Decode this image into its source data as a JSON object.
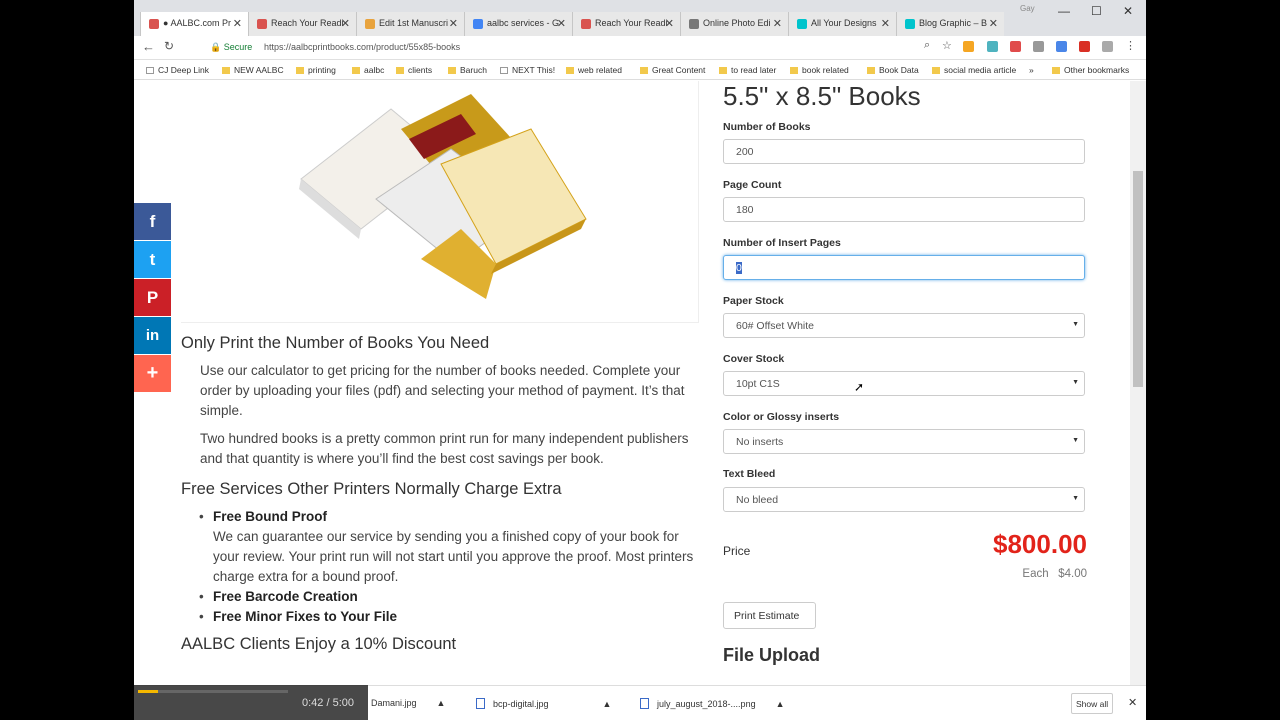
{
  "browser": {
    "tabs": [
      {
        "label": "● AALBC.com Pr",
        "color": "#d9534f"
      },
      {
        "label": "Reach Your Readi",
        "color": "#d9534f"
      },
      {
        "label": "Edit 1st Manuscri",
        "color": "#e8a33d"
      },
      {
        "label": "aalbc services - G",
        "color": "#4285f4"
      },
      {
        "label": "Reach Your Readi",
        "color": "#d9534f"
      },
      {
        "label": "Online Photo Edi",
        "color": "#777777"
      },
      {
        "label": "All Your Designs",
        "color": "#00c4cc"
      },
      {
        "label": "Blog Graphic – B",
        "color": "#00c4cc"
      }
    ],
    "user_label": "Gay",
    "secure_label": "Secure",
    "url": "https://aalbcprintbooks.com/product/55x85-books",
    "bookmarks": [
      "CJ Deep Link",
      "NEW AALBC",
      "printing",
      "aalbc",
      "clients",
      "Baruch",
      "NEXT This!",
      "web related",
      "Great Content",
      "to read later",
      "book related",
      "Book Data",
      "social media article"
    ],
    "other_bookmarks": "Other bookmarks"
  },
  "left": {
    "heading1": "Only Print the Number of Books You Need",
    "para1": "Use our calculator to get pricing for the number of books needed. Complete your order by uploading your files (pdf) and selecting your method of payment. It’s that simple.",
    "para2": "Two hundred books is a pretty common print run for many independent publishers and that quantity is where you’ll find the best cost savings per book.",
    "heading2": "Free Services Other Printers Normally Charge Extra",
    "bullet1_title": "Free Bound Proof",
    "bullet1_text": "We can guarantee our service by sending you a finished copy of your book for your review.  Your print run will not start until you approve the proof.  Most printers charge extra for a bound proof.",
    "bullet2_title": "Free Barcode Creation",
    "bullet3_title": "Free Minor Fixes to Your File",
    "heading3": "AALBC Clients Enjoy a 10% Discount"
  },
  "share": {
    "facebook": "f",
    "twitter": "t",
    "pinterest": "P",
    "linkedin": "in",
    "more": "+"
  },
  "form": {
    "title": "5.5\" x 8.5\" Books",
    "num_books_label": "Number of Books",
    "num_books_value": "200",
    "page_count_label": "Page Count",
    "page_count_value": "180",
    "insert_pages_label": "Number of Insert Pages",
    "insert_pages_value": "0",
    "paper_stock_label": "Paper Stock",
    "paper_stock_value": "60# Offset White",
    "cover_stock_label": "Cover Stock",
    "cover_stock_value": "10pt C1S",
    "glossy_label": "Color or Glossy inserts",
    "glossy_value": "No inserts",
    "bleed_label": "Text Bleed",
    "bleed_value": "No bleed",
    "price_label": "Price",
    "price_value": "$800.00",
    "each_label": "Each",
    "each_value": "$4.00",
    "estimate_button": "Print Estimate",
    "upload_title": "File Upload"
  },
  "downloads": {
    "items": [
      "Damani.jpg",
      "bcp-digital.jpg",
      "july_august_2018-....png"
    ],
    "show_all": "Show all"
  },
  "player": {
    "time": "0:42 / 5:00"
  }
}
